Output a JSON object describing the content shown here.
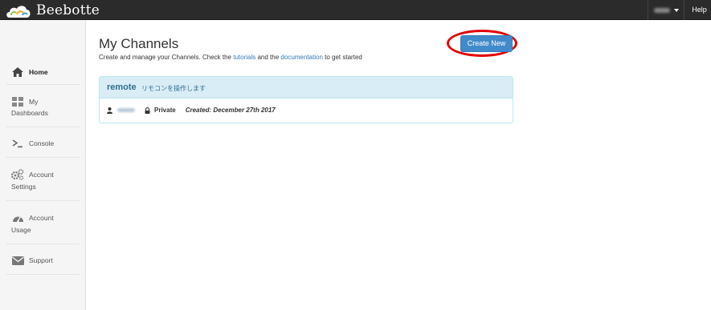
{
  "header": {
    "brand": "Beebotte",
    "help": "Help"
  },
  "sidebar": {
    "items": [
      {
        "icon": "home-icon",
        "label": "Home"
      },
      {
        "icon": "dashboards-icon",
        "label": "My",
        "label2": "Dashboards"
      },
      {
        "icon": "console-icon",
        "label": "Console"
      },
      {
        "icon": "gears-icon",
        "label": "Account",
        "label2": "Settings"
      },
      {
        "icon": "gauge-icon",
        "label": "Account",
        "label2": "Usage"
      },
      {
        "icon": "envelope-icon",
        "label": "Support"
      }
    ]
  },
  "main": {
    "title": "My Channels",
    "subtitle_pre": "Create and manage your Channels. Check the",
    "subtitle_link1": "tutorials",
    "subtitle_mid": "and the",
    "subtitle_link2": "documentation",
    "subtitle_post": "to get started",
    "create_button": "Create New"
  },
  "channel": {
    "name": "remote",
    "description": "リモコンを操作します",
    "visibility": "Private",
    "created": "Created: December 27th 2017"
  },
  "colors": {
    "accent": "#428bca",
    "highlight_ring": "#e10000",
    "panel_head": "#d9edf7"
  }
}
